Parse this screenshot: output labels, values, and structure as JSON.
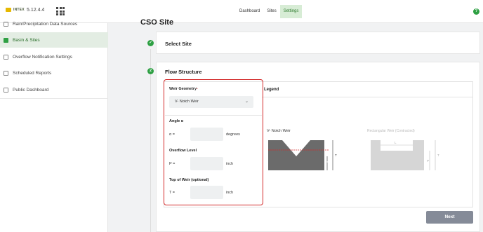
{
  "app": {
    "brand": "INTEX",
    "version": "5.12.4.4"
  },
  "nav": {
    "items": [
      {
        "label": "Dashboard",
        "active": false
      },
      {
        "label": "Sites",
        "active": false
      },
      {
        "label": "Settings",
        "active": true
      }
    ]
  },
  "sidebar": {
    "items": [
      {
        "label": "Rain/Precipitation Data Sources",
        "icon": "rain-gauge-icon",
        "active": false
      },
      {
        "label": "Basin & Sites",
        "icon": "basin-icon",
        "active": true
      },
      {
        "label": "Overflow Notification Settings",
        "icon": "bell-icon",
        "active": false
      },
      {
        "label": "Scheduled Reports",
        "icon": "report-icon",
        "active": false
      },
      {
        "label": "Public Dashboard",
        "icon": "dashboard-icon",
        "active": false
      }
    ]
  },
  "page": {
    "title": "CSO Site"
  },
  "steps": {
    "select_site": {
      "title": "Select Site",
      "icon": "check-icon"
    },
    "flow_structure": {
      "title": "Flow Structure",
      "number": "2"
    }
  },
  "form": {
    "weir_geometry_label": "Weir Geometry",
    "required_mark": "*",
    "weir_geometry_value": "V- Notch Weir",
    "angle_label": "Angle α",
    "angle_symbol": "α =",
    "angle_unit": "degrees",
    "angle_value": "",
    "overflow_label": "Overflow Level",
    "overflow_symbol": "P =",
    "overflow_unit": "inch",
    "overflow_value": "",
    "top_label": "Top of Weir (optional)",
    "top_symbol": "T =",
    "top_unit": "inch",
    "top_value": ""
  },
  "legend": {
    "title": "Legend",
    "vnotch_label": "V- Notch Weir",
    "rect_label": "Rectangular Weir (Contracted)",
    "vnotch_marks": {
      "alpha": "α",
      "t": "T",
      "p": "P"
    },
    "rect_marks": {
      "l": "L",
      "t": "T",
      "p": "P"
    }
  },
  "buttons": {
    "next": "Next"
  },
  "colors": {
    "accent": "#2ea043",
    "highlight_box": "#d32a2a",
    "button": "#858b98"
  }
}
